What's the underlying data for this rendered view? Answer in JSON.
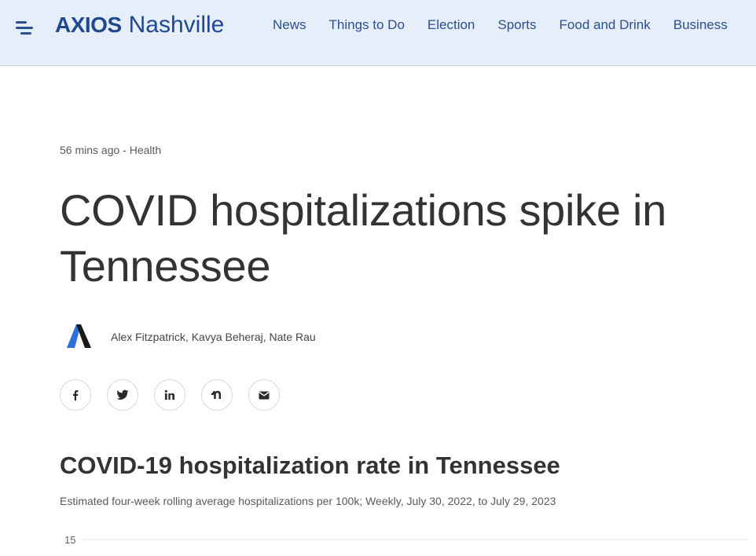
{
  "header": {
    "logo_brand": "AXIOS",
    "logo_city": "Nashville",
    "nav": [
      "News",
      "Things to Do",
      "Election",
      "Sports",
      "Food and Drink",
      "Business"
    ]
  },
  "article": {
    "meta": "56 mins ago - Health",
    "headline": "COVID hospitalizations spike in Tennessee",
    "authors": "Alex Fitzpatrick, Kavya Beheraj, Nate Rau",
    "share_icons": [
      "facebook-icon",
      "twitter-icon",
      "linkedin-icon",
      "nextdoor-icon",
      "email-icon"
    ]
  },
  "chart_data": {
    "type": "line",
    "title": "COVID-19 hospitalization rate in Tennessee",
    "subtitle": "Estimated four-week rolling average hospitalizations per 100k; Weekly, July 30, 2022, to July 29, 2023",
    "y_ticks": [
      "15"
    ],
    "grid": true
  },
  "colors": {
    "header_bg": "#e5eef9",
    "brand": "#1f4891",
    "nav_text": "#2b4f8f",
    "headline_text": "#333333"
  }
}
